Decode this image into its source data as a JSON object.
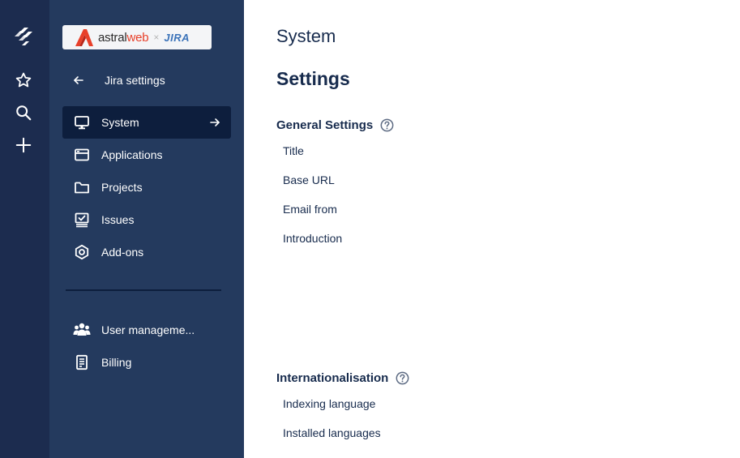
{
  "brand": {
    "name_part1": "astral",
    "name_part2": "web",
    "separator": "×",
    "partner": "JIRA"
  },
  "rail": {
    "icons": [
      "jira-logo-icon",
      "star-icon",
      "search-icon",
      "plus-icon"
    ]
  },
  "sidebar": {
    "back_label": "Jira settings",
    "items": [
      {
        "label": "System",
        "icon": "monitor-icon",
        "active": true
      },
      {
        "label": "Applications",
        "icon": "browser-window-icon"
      },
      {
        "label": "Projects",
        "icon": "folder-icon"
      },
      {
        "label": "Issues",
        "icon": "issues-icon"
      },
      {
        "label": "Add-ons",
        "icon": "addon-hexagon-icon"
      }
    ],
    "secondary_items": [
      {
        "label": "User manageme...",
        "icon": "people-icon"
      },
      {
        "label": "Billing",
        "icon": "invoice-icon"
      }
    ]
  },
  "main": {
    "breadcrumb_title": "System",
    "page_title": "Settings",
    "sections": [
      {
        "title": "General Settings",
        "fields": [
          "Title",
          "Base URL",
          "Email from",
          "Introduction"
        ]
      },
      {
        "title": "Internationalisation",
        "fields": [
          "Indexing language",
          "Installed languages"
        ]
      }
    ]
  },
  "colors": {
    "rail_bg": "#1c2c4f",
    "sidebar_bg": "#243a5e",
    "active_bg": "#0d1e3d",
    "text_dark": "#172b4d",
    "brand_red": "#e8402a",
    "jira_blue": "#3b73b9"
  }
}
